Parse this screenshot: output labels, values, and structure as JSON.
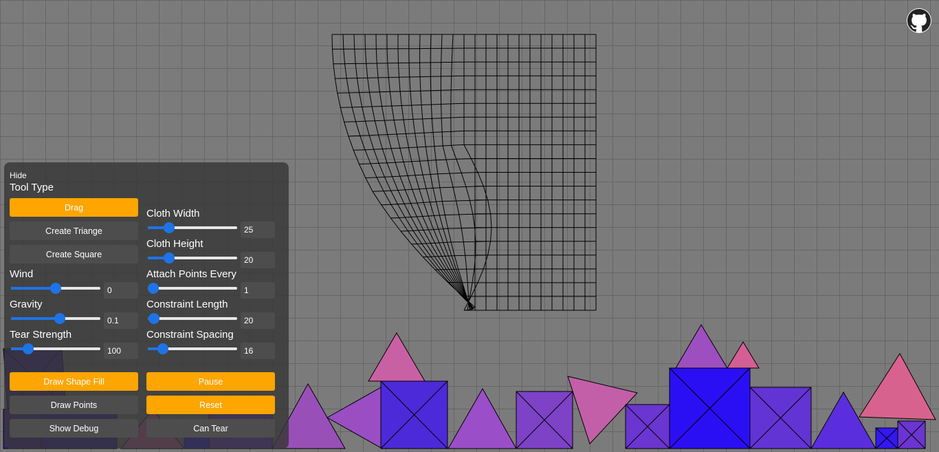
{
  "github": {
    "icon": "github-icon"
  },
  "panel": {
    "hide_label": "Hide",
    "tool_type_title": "Tool Type",
    "tools": [
      {
        "label": "Drag",
        "active": true
      },
      {
        "label": "Create Triange",
        "active": false
      },
      {
        "label": "Create Square",
        "active": false
      }
    ],
    "left_controls": [
      {
        "label": "Wind",
        "value": "0",
        "level": 0.5
      },
      {
        "label": "Gravity",
        "value": "0.1",
        "level": 0.55
      },
      {
        "label": "Tear Strength",
        "value": "100",
        "level": 0.15
      }
    ],
    "right_controls": [
      {
        "label": "Cloth Width",
        "value": "25",
        "level": 0.2
      },
      {
        "label": "Cloth Height",
        "value": "20",
        "level": 0.2
      },
      {
        "label": "Attach Points Every",
        "value": "1",
        "level": 0.0
      },
      {
        "label": "Constraint Length",
        "value": "20",
        "level": 0.01
      },
      {
        "label": "Constraint Spacing",
        "value": "16",
        "level": 0.12
      }
    ],
    "toggles_left": [
      {
        "label": "Draw Shape Fill",
        "active": true
      },
      {
        "label": "Draw Points",
        "active": false
      },
      {
        "label": "Show Debug",
        "active": false
      }
    ],
    "toggles_right": [
      {
        "label": "Pause",
        "active": true
      },
      {
        "label": "Reset",
        "active": true
      },
      {
        "label": "Can Tear",
        "active": false
      }
    ]
  },
  "colors": {
    "accent": "#ffa500",
    "button": "#4d4d4d",
    "slider": "#1e74e6",
    "background": "#7b7b7b"
  }
}
